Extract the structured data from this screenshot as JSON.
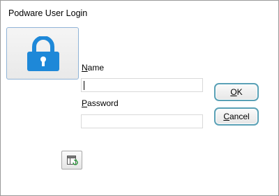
{
  "window": {
    "title": "Podware User Login"
  },
  "form": {
    "name_label_mnemonic": "N",
    "name_label_rest": "ame",
    "name_value": "",
    "password_label_mnemonic": "P",
    "password_label_rest": "assword",
    "password_value": ""
  },
  "buttons": {
    "ok_mnemonic": "O",
    "ok_rest": "K",
    "cancel_mnemonic": "C",
    "cancel_rest": "ancel"
  },
  "icons": {
    "lock": "lock-icon",
    "settings": "layout-refresh-icon"
  },
  "colors": {
    "lock_blue": "#1e88d8",
    "button_border": "#5aa1b6"
  }
}
